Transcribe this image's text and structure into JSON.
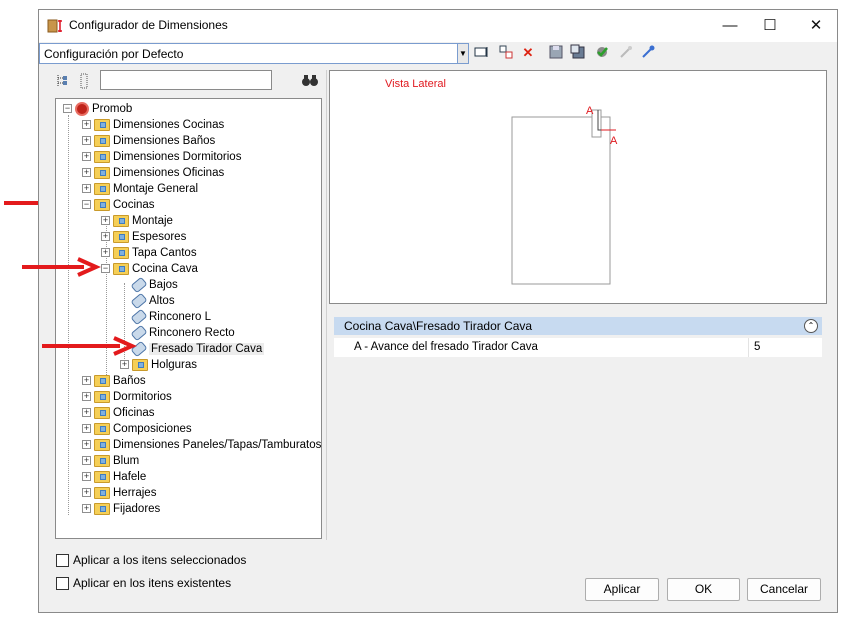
{
  "window": {
    "title": "Configurador de Dimensiones",
    "minimize": "—",
    "maximize": "☐",
    "close": "✕"
  },
  "toolbar": {
    "config_value": "Configuración por Defecto",
    "icons": [
      "rename-icon",
      "new-config-icon",
      "delete-icon",
      "save-icon",
      "save-as-icon",
      "settings-check-icon",
      "import-icon",
      "export-icon"
    ]
  },
  "tree": {
    "root": "Promob",
    "items_top": [
      "Dimensiones Cocinas",
      "Dimensiones Baños",
      "Dimensiones Dormitorios",
      "Dimensiones Oficinas",
      "Montaje General",
      "Cocinas"
    ],
    "cocinas_children": [
      "Montaje",
      "Espesores",
      "Tapa Cantos",
      "Cocina Cava"
    ],
    "cocina_cava_children": [
      "Bajos",
      "Altos",
      "Rinconero L",
      "Rinconero Recto",
      "Fresado Tirador Cava"
    ],
    "holguras": "Holguras",
    "items_bottom": [
      "Baños",
      "Dormitorios",
      "Oficinas",
      "Composiciones",
      "Dimensiones Paneles/Tapas/Tamburatos",
      "Blum",
      "Hafele",
      "Herrajes",
      "Fijadores"
    ]
  },
  "preview": {
    "label": "Vista Lateral",
    "marker_a1": "A",
    "marker_a2": "A",
    "accent_color": "#e0191f"
  },
  "properties": {
    "path": "Cocina Cava\\Fresado Tirador Cava",
    "rows": [
      {
        "name": "A -  Avance del fresado Tirador Cava",
        "value": "5"
      }
    ]
  },
  "options": {
    "apply_selected": "Aplicar a los itens seleccionados",
    "apply_existing": "Aplicar en los itens existentes"
  },
  "buttons": {
    "apply": "Aplicar",
    "ok": "OK",
    "cancel": "Cancelar"
  },
  "colors": {
    "header_band": "#c7daf0",
    "annotation_arrow": "#e31a1c"
  }
}
